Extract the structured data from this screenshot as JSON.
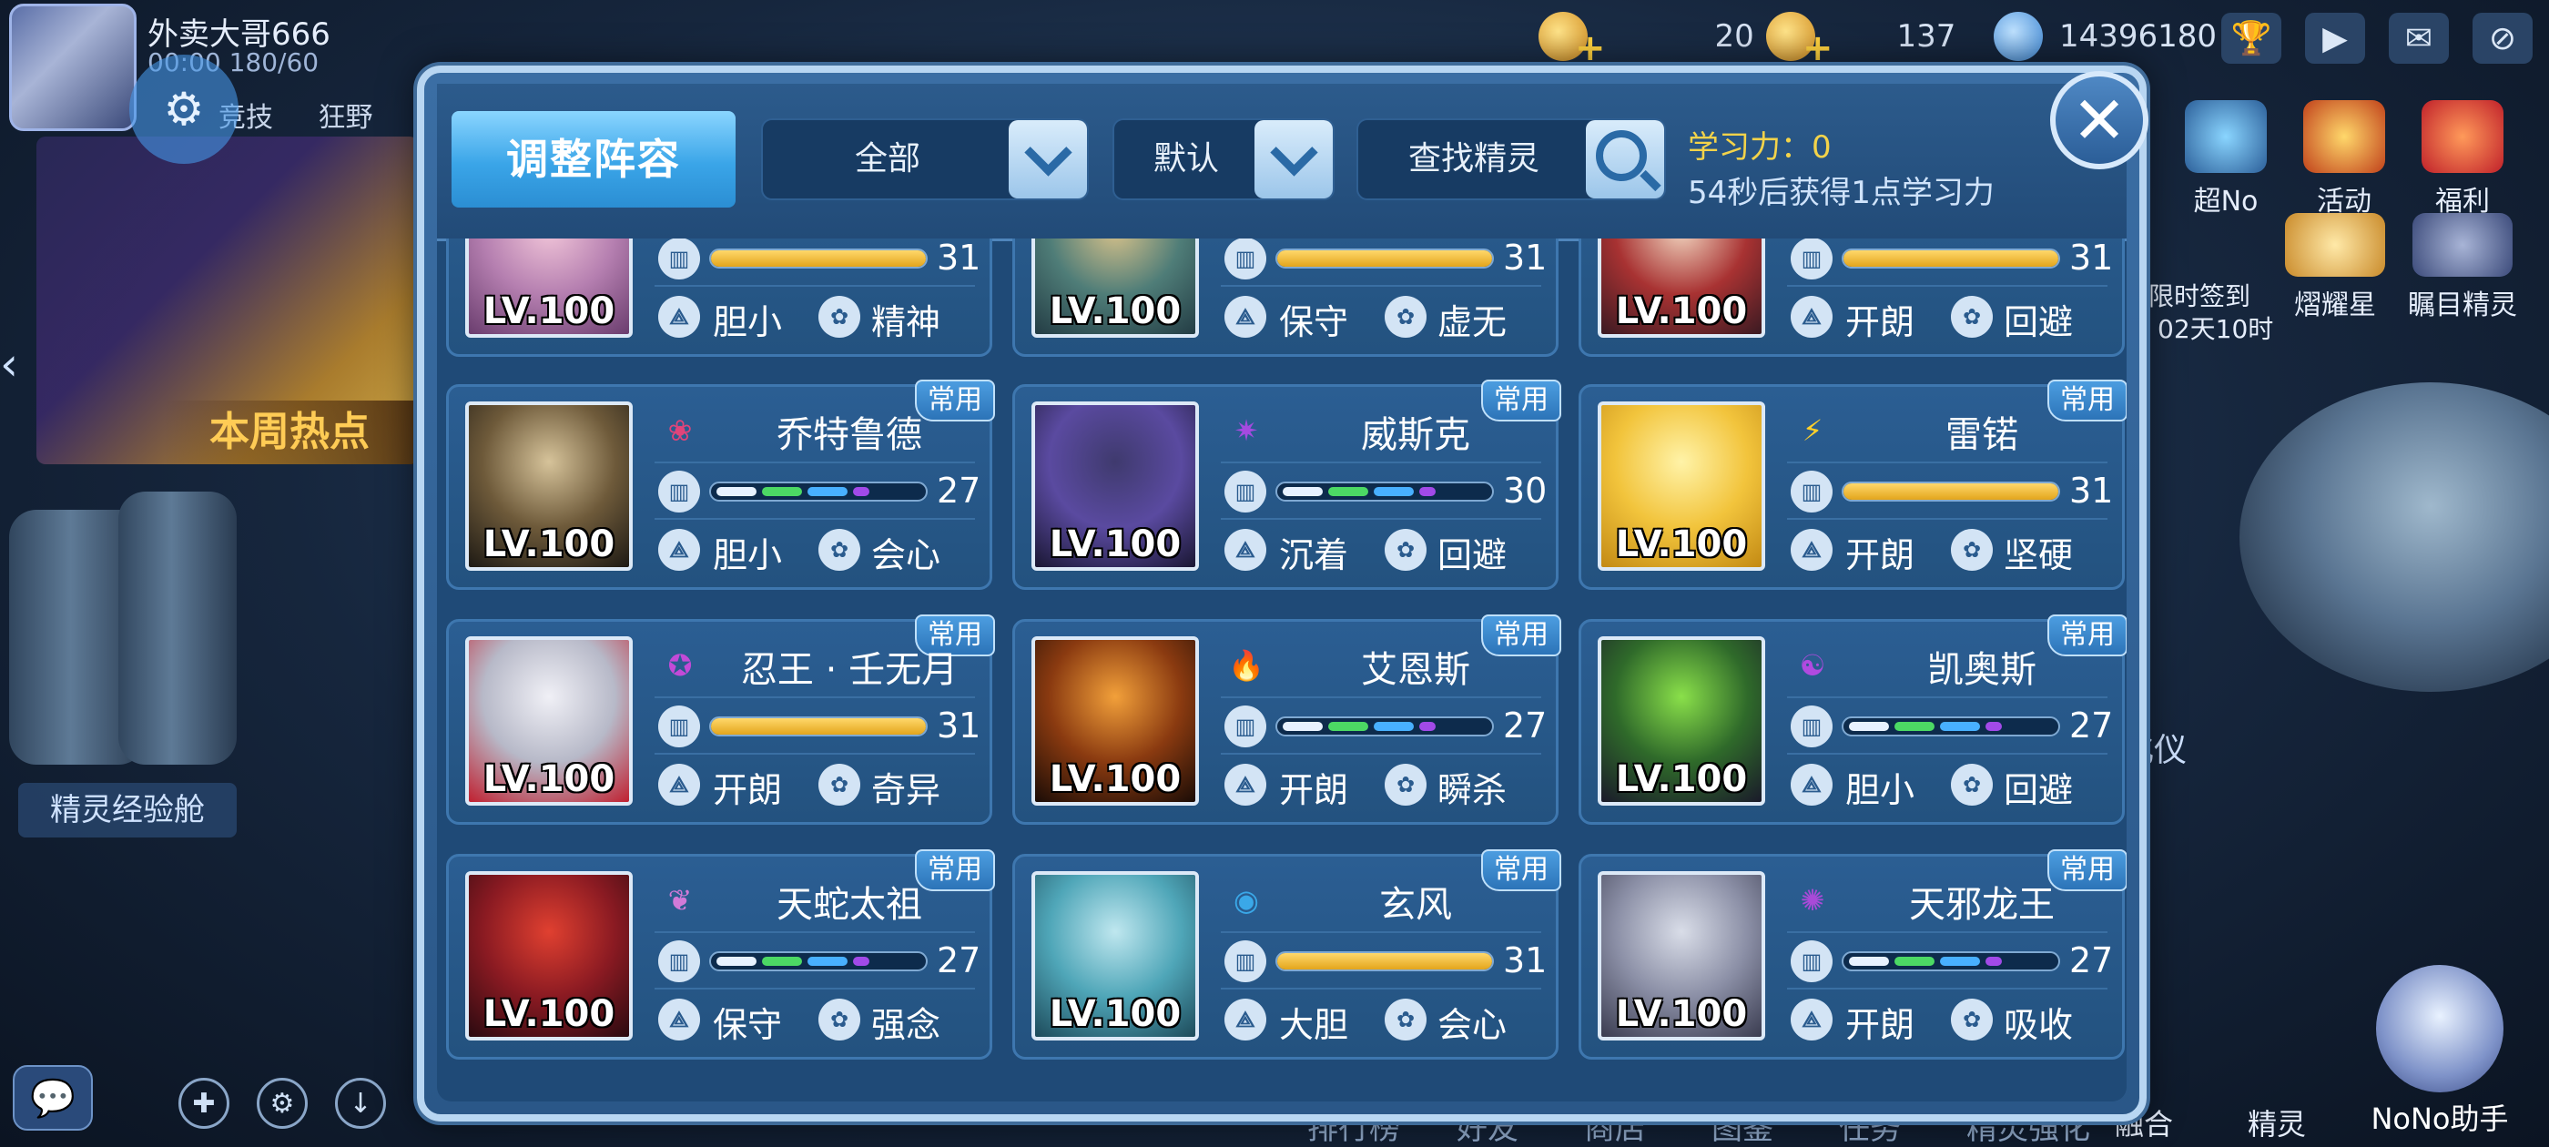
{
  "player": {
    "name": "外卖大哥666",
    "stats": "00:00  180/60",
    "tabs": [
      "竞技",
      "狂野"
    ]
  },
  "resources": [
    {
      "value": "20"
    },
    {
      "value": "137"
    },
    {
      "value": "14396180"
    }
  ],
  "top_right_features": [
    {
      "label": "超No"
    },
    {
      "label": "活动"
    },
    {
      "label": "福利"
    },
    {
      "label": "限时签到"
    },
    {
      "label": "熠耀星"
    },
    {
      "label": "瞩目精灵"
    }
  ],
  "signin_timer": "02天10时",
  "background": {
    "banner": "本周热点",
    "left_label": "精灵经验舱",
    "right_label": "化仪",
    "bottom_nav": [
      "排行榜",
      "好友",
      "商店",
      "图鉴",
      "任务",
      "精灵强化"
    ]
  },
  "bottom_tabs": [
    "融合",
    "精灵"
  ],
  "nono_label": "NoNo助手",
  "modal": {
    "title_button": "调整阵容",
    "filter_dropdown": "全部",
    "sort_dropdown": "默认",
    "search_label": "查找精灵",
    "study_power": "学习力：0",
    "study_timer": "54秒后获得1点学习力"
  },
  "badge_label": "常用",
  "cards": [
    {
      "name": "",
      "level": "LV.100",
      "iv": "31",
      "iv_type": "gold",
      "trait1": "胆小",
      "trait2": "精神",
      "badge": false,
      "attr_icon": "",
      "attr_color": "#d55",
      "portrait": [
        "#f2c6d9",
        "#b57fb0",
        "#6a3d6e"
      ]
    },
    {
      "name": "",
      "level": "LV.100",
      "iv": "31",
      "iv_type": "gold",
      "trait1": "保守",
      "trait2": "虚无",
      "badge": false,
      "attr_icon": "",
      "attr_color": "#d55",
      "portrait": [
        "#d8c28a",
        "#4f7d78",
        "#233c44"
      ]
    },
    {
      "name": "",
      "level": "LV.100",
      "iv": "31",
      "iv_type": "gold",
      "trait1": "开朗",
      "trait2": "回避",
      "badge": false,
      "attr_icon": "",
      "attr_color": "#d55",
      "portrait": [
        "#f2d6c0",
        "#a83232",
        "#3a1a22"
      ]
    },
    {
      "name": "乔特鲁德",
      "level": "LV.100",
      "iv": "27",
      "iv_type": "multi",
      "trait1": "胆小",
      "trait2": "会心",
      "badge": true,
      "attr_icon": "❀",
      "attr_color": "#e0447a",
      "portrait": [
        "#d6c39a",
        "#6e5a3a",
        "#1e1a14"
      ]
    },
    {
      "name": "威斯克",
      "level": "LV.100",
      "iv": "30",
      "iv_type": "multi",
      "trait1": "沉着",
      "trait2": "回避",
      "badge": true,
      "attr_icon": "✷",
      "attr_color": "#a44ae0",
      "portrait": [
        "#3f3a6e",
        "#5a4aa0",
        "#1a1733"
      ]
    },
    {
      "name": "雷锘",
      "level": "LV.100",
      "iv": "31",
      "iv_type": "gold",
      "trait1": "开朗",
      "trait2": "坚硬",
      "badge": true,
      "attr_icon": "⚡",
      "attr_color": "#ffd02a",
      "portrait": [
        "#fff3a8",
        "#f2c43c",
        "#c38a14"
      ]
    },
    {
      "name": "忍王 · 壬无月",
      "level": "LV.100",
      "iv": "31",
      "iv_type": "gold",
      "trait1": "开朗",
      "trait2": "奇异",
      "badge": true,
      "attr_icon": "✪",
      "attr_color": "#c24ad8",
      "portrait": [
        "#f0f0f6",
        "#b7b9c8",
        "#c02030"
      ]
    },
    {
      "name": "艾恩斯",
      "level": "LV.100",
      "iv": "27",
      "iv_type": "multi",
      "trait1": "开朗",
      "trait2": "瞬杀",
      "badge": true,
      "attr_icon": "🔥",
      "attr_color": "#ff6a1a",
      "portrait": [
        "#f2a03a",
        "#8a3a10",
        "#1a0c06"
      ]
    },
    {
      "name": "凯奥斯",
      "level": "LV.100",
      "iv": "27",
      "iv_type": "multi",
      "trait1": "胆小",
      "trait2": "回避",
      "badge": true,
      "attr_icon": "☯",
      "attr_color": "#b04ae0",
      "portrait": [
        "#8ae04a",
        "#2f6a2a",
        "#1a1a2a"
      ]
    },
    {
      "name": "天蛇太祖",
      "level": "LV.100",
      "iv": "27",
      "iv_type": "multi",
      "trait1": "保守",
      "trait2": "强念",
      "badge": true,
      "attr_icon": "❦",
      "attr_color": "#d07ad8",
      "portrait": [
        "#e04030",
        "#8a1a22",
        "#2a0a10"
      ]
    },
    {
      "name": "玄风",
      "level": "LV.100",
      "iv": "31",
      "iv_type": "gold",
      "trait1": "大胆",
      "trait2": "会心",
      "badge": true,
      "attr_icon": "◉",
      "attr_color": "#3aa8e8",
      "portrait": [
        "#bfe7ef",
        "#4fa6b8",
        "#1d4a5a"
      ]
    },
    {
      "name": "天邪龙王",
      "level": "LV.100",
      "iv": "27",
      "iv_type": "multi",
      "trait1": "开朗",
      "trait2": "吸收",
      "badge": true,
      "attr_icon": "✺",
      "attr_color": "#a84ad8",
      "portrait": [
        "#d9dde8",
        "#8b8fa6",
        "#3a3c50"
      ]
    }
  ]
}
